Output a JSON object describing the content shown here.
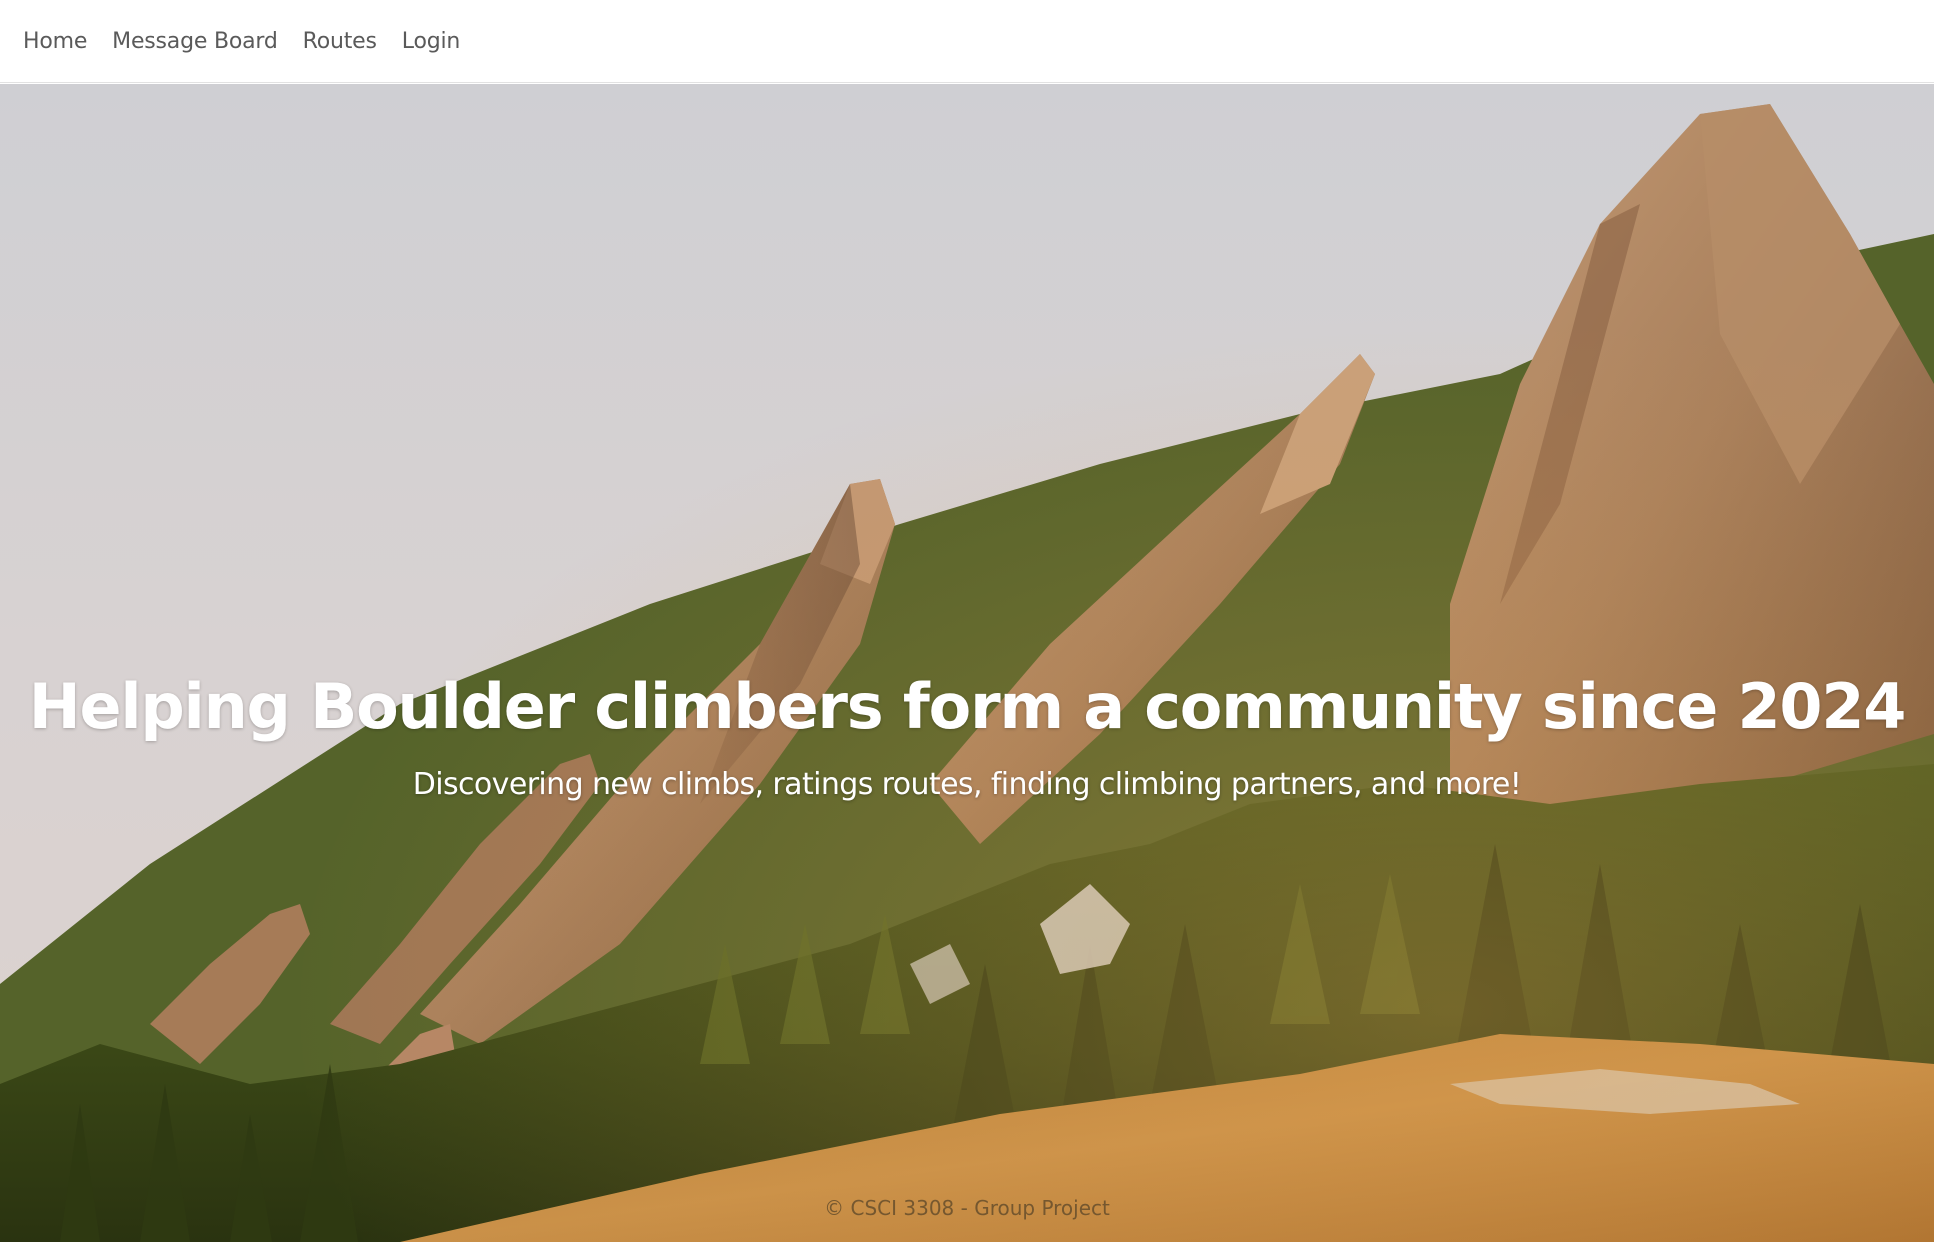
{
  "nav": {
    "items": [
      {
        "label": "Home"
      },
      {
        "label": "Message Board"
      },
      {
        "label": "Routes"
      },
      {
        "label": "Login"
      }
    ]
  },
  "hero": {
    "image_subject": "flatirons-mountain-photo",
    "headline": "Helping Boulder climbers form a community since 2024",
    "subheadline": "Discovering new climbs, ratings routes, finding climbing partners, and more!"
  },
  "footer": {
    "text": "© CSCI 3308 - Group Project"
  },
  "colors": {
    "nav_bg": "#ffffff",
    "nav_text": "#5a5a5a",
    "hero_text": "#ffffff"
  }
}
